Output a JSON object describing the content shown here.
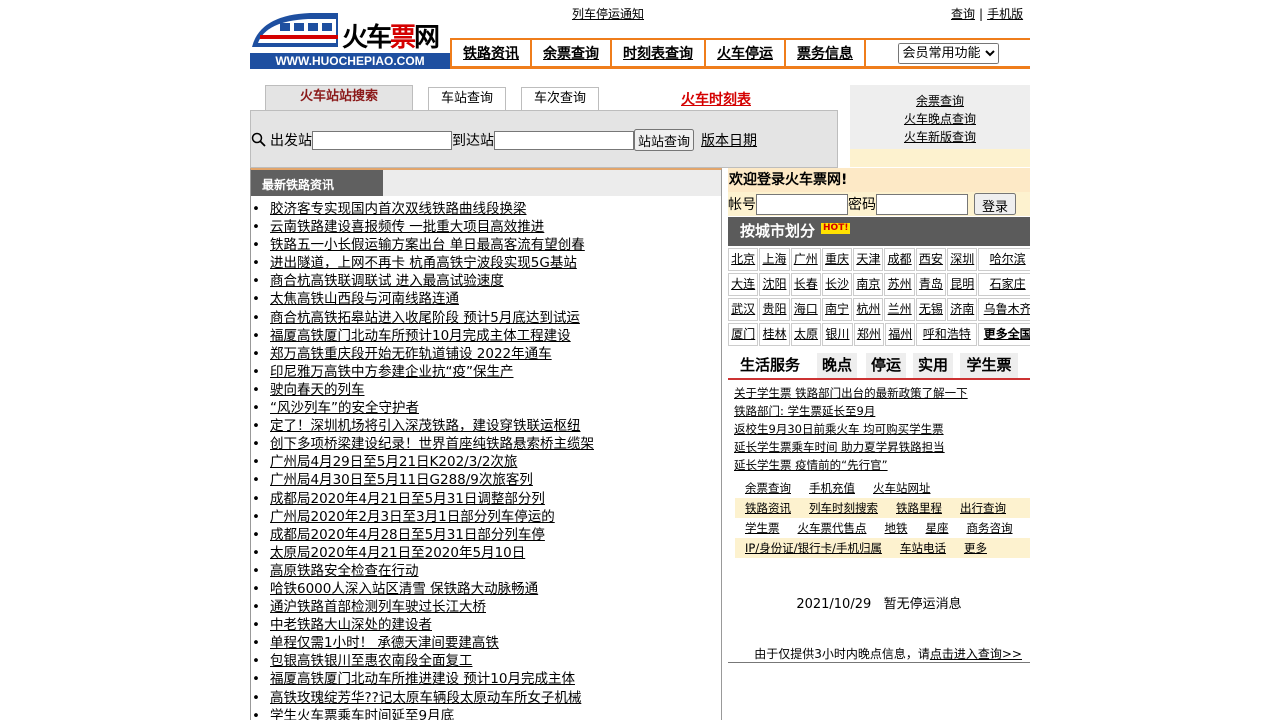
{
  "header": {
    "logo_text_black": "火车",
    "logo_text_red": "票",
    "logo_text_black2": "网",
    "logo_url": "WWW.HUOCHEPIAO.COM",
    "notice": "列车停运通知",
    "top_links": [
      "查询",
      "手机版"
    ],
    "nav": [
      "铁路资讯",
      "余票查询",
      "时刻表查询",
      "火车停运",
      "票务信息"
    ],
    "member_select": "会员常用功能"
  },
  "search": {
    "tabs": [
      "火车站站搜索",
      "车站查询",
      "车次查询"
    ],
    "timetable_link": "火车时刻表",
    "from_label": "出发站",
    "to_label": "到达站",
    "button": "站站查询",
    "version_date": "版本日期"
  },
  "quick_links": [
    "余票查询",
    "火车晚点查询",
    "火车新版查询"
  ],
  "news": {
    "title": "最新铁路资讯",
    "items": [
      "胶济客专实现国内首次双线铁路曲线段换梁",
      "云南铁路建设喜报频传 一批重大项目高效推进",
      "铁路五一小长假运输方案出台 单日最高客流有望创春",
      "进出隧道，上网不再卡 杭甬高铁宁波段实现5G基站",
      "商合杭高铁联调联试 进入最高试验速度",
      "太焦高铁山西段与河南线路连通",
      "商合杭高铁拓皋站进入收尾阶段 预计5月底达到试运",
      "福厦高铁厦门北动车所预计10月完成主体工程建设",
      "郑万高铁重庆段开始无砟轨道铺设 2022年通车",
      "印尼雅万高铁中方参建企业抗“疫”保生产",
      "驶向春天的列车",
      "“风沙列车”的安全守护者",
      "定了！深圳机场将引入深茂铁路，建设穿铁联运枢纽",
      "创下多项桥梁建设纪录！世界首座纯铁路悬索桥主缆架",
      "广州局4月29日至5月21日K202/3/2次旅",
      "广州局4月30日至5月11日G288/9次旅客列",
      "成都局2020年4月21日至5月31日调整部分列",
      "广州局2020年2月3日至3月1日部分列车停运的",
      "成都局2020年4月28日至5月31日部分列车停",
      "太原局2020年4月21日至2020年5月10日",
      "高原铁路安全检查在行动",
      "哈铁6000人深入站区清雪 保铁路大动脉畅通",
      "通沪铁路首部检测列车驶过长江大桥",
      "中老铁路大山深处的建设者",
      "单程仅需1小时！ 承德天津间要建高铁",
      "包银高铁银川至惠农南段全面复工",
      "福厦高铁厦门北动车所推进建设 预计10月完成主体",
      "高铁玫瑰绽芳华??记太原车辆段太原动车所女子机械",
      "学生火车票乘车时间延至9月底"
    ]
  },
  "login": {
    "welcome": "欢迎登录火车票网!",
    "account_label": "帐号",
    "password_label": "密码",
    "button": "登录"
  },
  "cities": {
    "title": "按城市划分",
    "hot": "HOT!",
    "rows": [
      [
        "北京",
        "上海",
        "广州",
        "重庆",
        "天津",
        "成都",
        "西安",
        "深圳",
        "哈尔滨"
      ],
      [
        "大连",
        "沈阳",
        "长春",
        "长沙",
        "南京",
        "苏州",
        "青岛",
        "昆明",
        "石家庄"
      ],
      [
        "武汉",
        "贵阳",
        "海口",
        "南宁",
        "杭州",
        "兰州",
        "无锡",
        "济南",
        "乌鲁木齐"
      ],
      [
        "厦门",
        "桂林",
        "太原",
        "银川",
        "郑州",
        "福州",
        "呼和浩特",
        "更多全国"
      ]
    ]
  },
  "life": {
    "tabs": [
      "生活服务",
      "晚点",
      "停运",
      "实用",
      "学生票"
    ],
    "news": [
      "关于学生票 铁路部门出台的最新政策了解一下",
      "铁路部门: 学生票延长至9月",
      "返校生9月30日前乘火车 均可购买学生票",
      "延长学生票乘车时间 助力夏学昇铁路担当",
      "延长学生票 疫情前的“先行官”"
    ],
    "links": [
      [
        "余票查询",
        "手机充值",
        "火车站网址"
      ],
      [
        "铁路资讯",
        "列车时刻搜索",
        "铁路里程",
        "出行查询"
      ],
      [
        "学生票",
        "火车票代售点",
        "地铁",
        "星座",
        "商务咨询"
      ],
      [
        "IP/身份证/银行卡/手机归属",
        "车站电话",
        "更多"
      ]
    ]
  },
  "stop_notice": {
    "date": "2021/10/29",
    "text": "暂无停运消息"
  },
  "footnote": {
    "prefix": "由于仅提供3小时内晚点信息，请",
    "link": "点击进入查询>>"
  }
}
